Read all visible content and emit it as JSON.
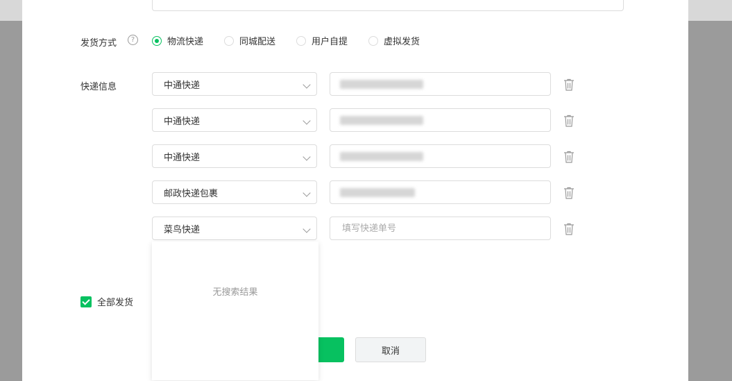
{
  "shipping_method": {
    "label": "发货方式",
    "help_icon": "?",
    "options": [
      {
        "label": "物流快递",
        "selected": true
      },
      {
        "label": "同城配送",
        "selected": false
      },
      {
        "label": "用户自提",
        "selected": false
      },
      {
        "label": "虚拟发货",
        "selected": false
      }
    ]
  },
  "express_info": {
    "label": "快递信息",
    "rows": [
      {
        "carrier": "中通快递",
        "tracking_placeholder": ""
      },
      {
        "carrier": "中通快递",
        "tracking_placeholder": ""
      },
      {
        "carrier": "中通快递",
        "tracking_placeholder": ""
      },
      {
        "carrier": "邮政快递包裹",
        "tracking_placeholder": ""
      },
      {
        "carrier": "菜鸟快递",
        "tracking_placeholder": "填写快递单号"
      }
    ]
  },
  "dropdown": {
    "empty_text": "无搜索结果"
  },
  "ship_all": {
    "label": "全部发货",
    "checked": true
  },
  "actions": {
    "cancel_label": "取消"
  },
  "colors": {
    "accent": "#07c160"
  }
}
